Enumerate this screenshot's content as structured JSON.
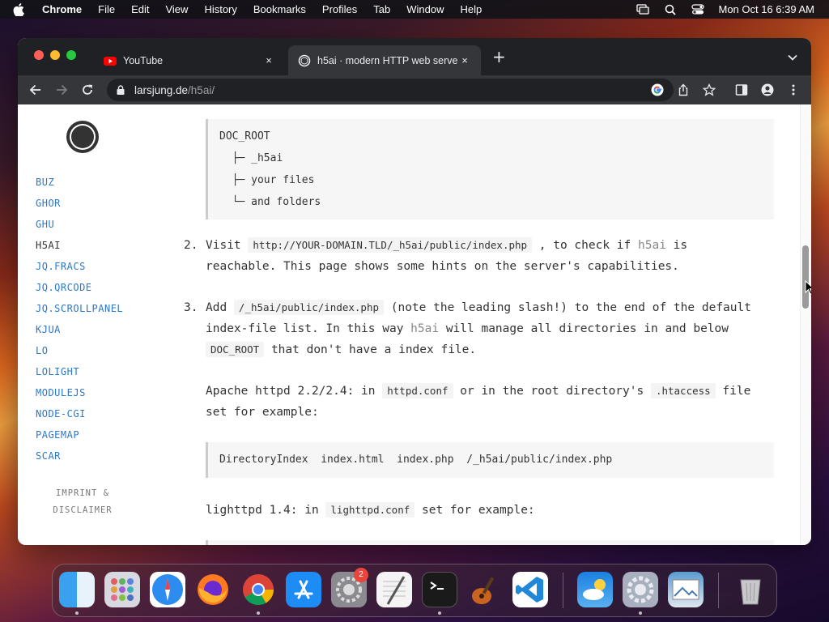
{
  "menubar": {
    "app": "Chrome",
    "items": [
      "File",
      "Edit",
      "View",
      "History",
      "Bookmarks",
      "Profiles",
      "Tab",
      "Window",
      "Help"
    ],
    "clock": "Mon Oct 16  6:39 AM"
  },
  "tabs": [
    {
      "title": "YouTube",
      "close": "×"
    },
    {
      "title": "h5ai · modern HTTP web serve",
      "close": "×"
    }
  ],
  "newtab": "+",
  "address": {
    "host": "larsjung.de",
    "path": "/h5ai/"
  },
  "sidenav": [
    "BUZ",
    "GHOR",
    "GHU",
    "H5AI",
    "JQ.FRACS",
    "JQ.QRCODE",
    "JQ.SCROLLPANEL",
    "KJUA",
    "LO",
    "LOLIGHT",
    "MODULEJS",
    "NODE-CGI",
    "PAGEMAP",
    "SCAR"
  ],
  "imprint": {
    "line1": "IMPRINT &",
    "line2": "DISCLAIMER"
  },
  "tree": [
    "DOC_ROOT",
    "  ├─ _h5ai",
    "  ├─ your files",
    "  └─ and folders"
  ],
  "step2": {
    "num": "2.",
    "t1": "Visit ",
    "code1": "http://YOUR-DOMAIN.TLD/_h5ai/public/index.php",
    "t2": " , to check if ",
    "hl": "h5ai",
    "t3": " is",
    "line2": "reachable. This page shows some hints on the server's capabilities."
  },
  "step3": {
    "num": "3.",
    "t1": "Add ",
    "code1": "/_h5ai/public/index.php",
    "t2": " (note the leading slash!) to the end of the default",
    "t3": "index-file list. In this way ",
    "hl": "h5ai",
    "t4": " will manage all directories in and below",
    "code2": "DOC_ROOT",
    "t5": " that don't have a index file."
  },
  "apache": {
    "t1": "Apache httpd 2.2/2.4: in ",
    "code1": "httpd.conf",
    "t2": " or in the root directory's ",
    "code2": ".htaccess",
    "t3": " file",
    "line2": "set for example:"
  },
  "apache_code": "DirectoryIndex  index.html  index.php  /_h5ai/public/index.php",
  "lighttpd": {
    "t1": "lighttpd 1.4: in ",
    "code1": "lighttpd.conf",
    "t2": " set for example:"
  },
  "dock": {
    "settings_badge": "2"
  }
}
